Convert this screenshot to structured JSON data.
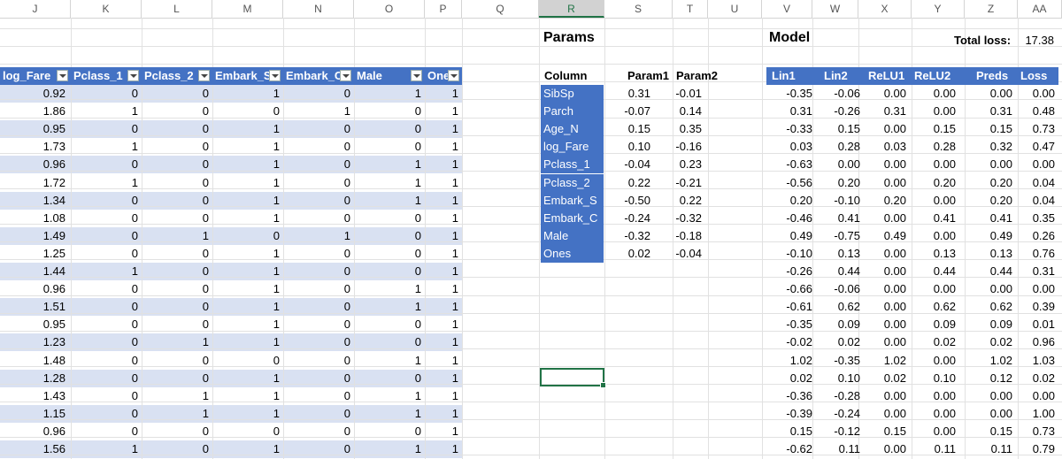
{
  "columns": [
    "J",
    "K",
    "L",
    "M",
    "N",
    "O",
    "P",
    "Q",
    "R",
    "S",
    "T",
    "U",
    "V",
    "W",
    "X",
    "Y",
    "Z",
    "AA"
  ],
  "left_table": {
    "headers": [
      "log_Fare",
      "Pclass_1",
      "Pclass_2",
      "Embark_S",
      "Embark_C",
      "Male",
      "Ones"
    ],
    "rows": [
      [
        "0.92",
        "0",
        "0",
        "1",
        "0",
        "1",
        "1"
      ],
      [
        "1.86",
        "1",
        "0",
        "0",
        "1",
        "0",
        "1"
      ],
      [
        "0.95",
        "0",
        "0",
        "1",
        "0",
        "0",
        "1"
      ],
      [
        "1.73",
        "1",
        "0",
        "1",
        "0",
        "0",
        "1"
      ],
      [
        "0.96",
        "0",
        "0",
        "1",
        "0",
        "1",
        "1"
      ],
      [
        "1.72",
        "1",
        "0",
        "1",
        "0",
        "1",
        "1"
      ],
      [
        "1.34",
        "0",
        "0",
        "1",
        "0",
        "1",
        "1"
      ],
      [
        "1.08",
        "0",
        "0",
        "1",
        "0",
        "0",
        "1"
      ],
      [
        "1.49",
        "0",
        "1",
        "0",
        "1",
        "0",
        "1"
      ],
      [
        "1.25",
        "0",
        "0",
        "1",
        "0",
        "0",
        "1"
      ],
      [
        "1.44",
        "1",
        "0",
        "1",
        "0",
        "0",
        "1"
      ],
      [
        "0.96",
        "0",
        "0",
        "1",
        "0",
        "1",
        "1"
      ],
      [
        "1.51",
        "0",
        "0",
        "1",
        "0",
        "1",
        "1"
      ],
      [
        "0.95",
        "0",
        "0",
        "1",
        "0",
        "0",
        "1"
      ],
      [
        "1.23",
        "0",
        "1",
        "1",
        "0",
        "0",
        "1"
      ],
      [
        "1.48",
        "0",
        "0",
        "0",
        "0",
        "1",
        "1"
      ],
      [
        "1.28",
        "0",
        "0",
        "1",
        "0",
        "0",
        "1"
      ],
      [
        "1.43",
        "0",
        "1",
        "1",
        "0",
        "1",
        "1"
      ],
      [
        "1.15",
        "0",
        "1",
        "1",
        "0",
        "1",
        "1"
      ],
      [
        "0.96",
        "0",
        "0",
        "0",
        "0",
        "0",
        "1"
      ],
      [
        "1.56",
        "1",
        "0",
        "1",
        "0",
        "1",
        "1"
      ]
    ]
  },
  "params": {
    "title": "Params",
    "headers": [
      "Column",
      "Param1",
      "Param2"
    ],
    "rows": [
      [
        "SibSp",
        "0.31",
        "-0.01"
      ],
      [
        "Parch",
        "-0.07",
        "0.14"
      ],
      [
        "Age_N",
        "0.15",
        "0.35"
      ],
      [
        "log_Fare",
        "0.10",
        "-0.16"
      ],
      [
        "Pclass_1",
        "-0.04",
        "0.23"
      ],
      [
        "Pclass_2",
        "0.22",
        "-0.21"
      ],
      [
        "Embark_S",
        "-0.50",
        "0.22"
      ],
      [
        "Embark_C",
        "-0.24",
        "-0.32"
      ],
      [
        "Male",
        "-0.32",
        "-0.18"
      ],
      [
        "Ones",
        "0.02",
        "-0.04"
      ]
    ]
  },
  "model": {
    "title": "Model",
    "total_loss_label": "Total loss:",
    "total_loss_value": "17.38",
    "headers": [
      "Lin1",
      "Lin2",
      "ReLU1",
      "ReLU2",
      "Preds",
      "Loss"
    ],
    "rows": [
      [
        "-0.35",
        "-0.06",
        "0.00",
        "0.00",
        "0.00",
        "0.00"
      ],
      [
        "0.31",
        "-0.26",
        "0.31",
        "0.00",
        "0.31",
        "0.48"
      ],
      [
        "-0.33",
        "0.15",
        "0.00",
        "0.15",
        "0.15",
        "0.73"
      ],
      [
        "0.03",
        "0.28",
        "0.03",
        "0.28",
        "0.32",
        "0.47"
      ],
      [
        "-0.63",
        "0.00",
        "0.00",
        "0.00",
        "0.00",
        "0.00"
      ],
      [
        "-0.56",
        "0.20",
        "0.00",
        "0.20",
        "0.20",
        "0.04"
      ],
      [
        "0.20",
        "-0.10",
        "0.20",
        "0.00",
        "0.20",
        "0.04"
      ],
      [
        "-0.46",
        "0.41",
        "0.00",
        "0.41",
        "0.41",
        "0.35"
      ],
      [
        "0.49",
        "-0.75",
        "0.49",
        "0.00",
        "0.49",
        "0.26"
      ],
      [
        "-0.10",
        "0.13",
        "0.00",
        "0.13",
        "0.13",
        "0.76"
      ],
      [
        "-0.26",
        "0.44",
        "0.00",
        "0.44",
        "0.44",
        "0.31"
      ],
      [
        "-0.66",
        "-0.06",
        "0.00",
        "0.00",
        "0.00",
        "0.00"
      ],
      [
        "-0.61",
        "0.62",
        "0.00",
        "0.62",
        "0.62",
        "0.39"
      ],
      [
        "-0.35",
        "0.09",
        "0.00",
        "0.09",
        "0.09",
        "0.01"
      ],
      [
        "-0.02",
        "0.02",
        "0.00",
        "0.02",
        "0.02",
        "0.96"
      ],
      [
        "1.02",
        "-0.35",
        "1.02",
        "0.00",
        "1.02",
        "1.03"
      ],
      [
        "0.02",
        "0.10",
        "0.02",
        "0.10",
        "0.12",
        "0.02"
      ],
      [
        "-0.36",
        "-0.28",
        "0.00",
        "0.00",
        "0.00",
        "0.00"
      ],
      [
        "-0.39",
        "-0.24",
        "0.00",
        "0.00",
        "0.00",
        "1.00"
      ],
      [
        "0.15",
        "-0.12",
        "0.15",
        "0.00",
        "0.15",
        "0.73"
      ],
      [
        "-0.62",
        "0.11",
        "0.00",
        "0.11",
        "0.11",
        "0.79"
      ]
    ]
  },
  "selected_column": "R",
  "colors": {
    "table_header": "#4472c4",
    "band": "#d9e1f2",
    "selection": "#217346"
  }
}
